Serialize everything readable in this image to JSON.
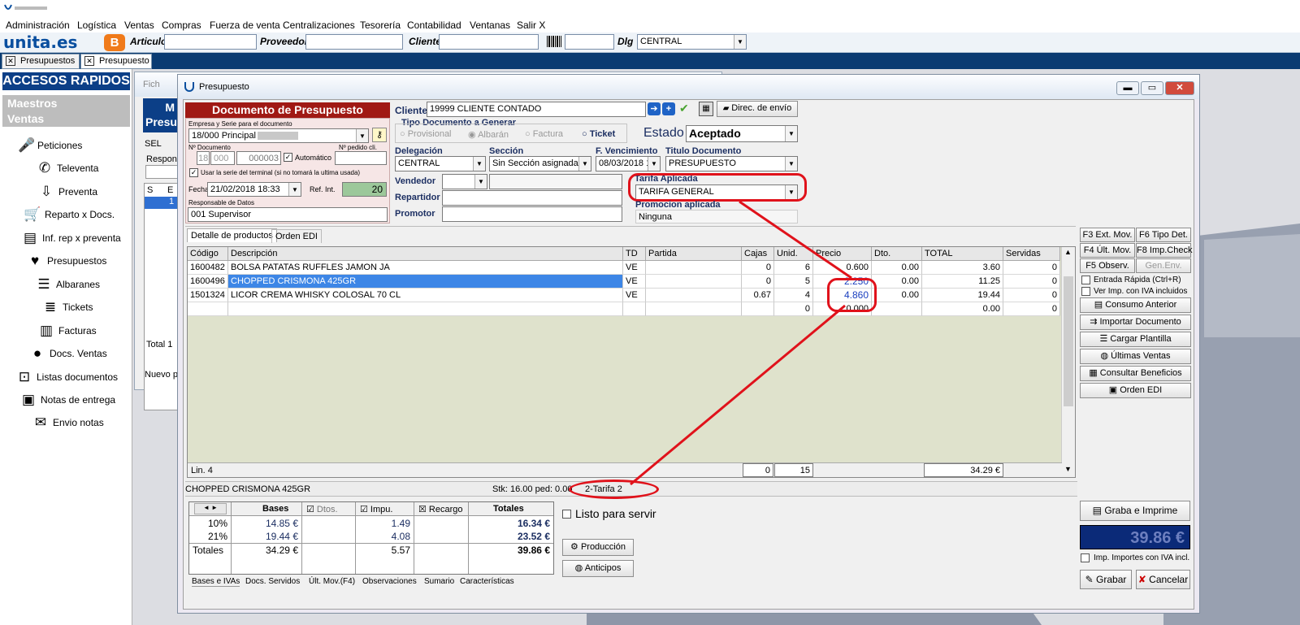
{
  "menu": [
    "Administración",
    "Logística",
    "Ventas",
    "Compras",
    "Fuerza de venta",
    "Centralizaciones",
    "Tesorería",
    "Contabilidad",
    "Ventanas",
    "Salir X"
  ],
  "toolbar": {
    "brand": "unita.es",
    "articulo_label": "Articulo",
    "proveedor_label": "Proveedor",
    "cliente_label": "Cliente",
    "dlg_label": "Dlg",
    "dlg_value": "CENTRAL"
  },
  "tabs": [
    "Presupuestos",
    "Presupuesto"
  ],
  "sidebar": {
    "title": "ACCESOS RAPIDOS",
    "section1": "Maestros",
    "section2": "Ventas",
    "items": [
      "Peticiones",
      "Televenta",
      "Preventa",
      "Reparto x Docs.",
      "Inf. rep x preventa",
      "Presupuestos",
      "Albaranes",
      "Tickets",
      "Facturas",
      "Docs. Ventas",
      "Listas documentos",
      "Notas de entrega",
      "Envio notas"
    ]
  },
  "bgwin": {
    "title": "Fich",
    "lines": [
      "M",
      "Presu"
    ],
    "sel": "SEL",
    "respon": "Respon",
    "col_s": "S",
    "col_e": "E",
    "row_val": "1",
    "total": "Total 1",
    "nuevo": "Nuevo p"
  },
  "win": {
    "title": "Presupuesto",
    "doc_header": "Documento de Presupuesto",
    "empresa_label": "Empresa y Serie para el documento",
    "empresa_value": "18/000 Principal",
    "ndoc_label": "Nº Documento",
    "npedido_label": "Nº pedido cli.",
    "ndoc_a": "18",
    "ndoc_b": "000",
    "ndoc_c": "000003",
    "automatico": "Automático",
    "usar_serie": "Usar la serie del terminal  (si no tomará la ultima usada)",
    "fecha_label": "Fecha",
    "fecha_value": "21/02/2018 18:33",
    "refint_label": "Ref. Int.",
    "refint_value": "20",
    "resp_label": "Responsable de Datos",
    "resp_value": "001 Supervisor",
    "cliente_label": "Cliente",
    "cliente_value": "19999 CLIENTE CONTADO",
    "direc_envio": "Direc. de envío",
    "tipo_doc_label": "Tipo Documento a Generar",
    "tipo_opts": [
      "Provisional",
      "Albarán",
      "Factura",
      "Ticket"
    ],
    "estado_label": "Estado",
    "estado_value": "Aceptado",
    "delegacion_label": "Delegación",
    "delegacion_value": "CENTRAL",
    "seccion_label": "Sección",
    "seccion_value": "Sin Sección asignada",
    "fvenc_label": "F. Vencimiento",
    "fvenc_value": "08/03/2018 1",
    "titulo_label": "Titulo Documento",
    "titulo_value": "PRESUPUESTO",
    "vendedor_label": "Vendedor",
    "repartidor_label": "Repartidor",
    "promotor_label": "Promotor",
    "tarifa_label": "Tarifa Aplicada",
    "tarifa_value": "TARIFA GENERAL",
    "promo_label": "Promocion aplicada",
    "promo_value": "Ninguna",
    "detail_tabs": [
      "Detalle de productos",
      "Orden EDI"
    ],
    "columns": [
      "Código",
      "Descripción",
      "TD",
      "Partida",
      "Cajas",
      "Unid.",
      "Precio",
      "Dto.",
      "TOTAL",
      "Servidas"
    ],
    "rows": [
      [
        "1600482",
        "BOLSA PATATAS RUFFLES JAMON JA",
        "VE",
        "",
        "0",
        "6",
        "0.600",
        "0.00",
        "3.60",
        "0"
      ],
      [
        "1600496",
        "CHOPPED CRISMONA 425GR",
        "VE",
        "",
        "0",
        "5",
        "2.250",
        "0.00",
        "11.25",
        "0"
      ],
      [
        "1501324",
        "LICOR CREMA WHISKY COLOSAL 70 CL",
        "VE",
        "",
        "0.67",
        "4",
        "4.860",
        "0.00",
        "19.44",
        "0"
      ],
      [
        "",
        "",
        "",
        "",
        "",
        "0",
        "0.000",
        "",
        "0.00",
        "0"
      ]
    ],
    "footer_lin": "Lin. 4",
    "footer_cajas": "0",
    "footer_unid": "15",
    "footer_total": "34.29 €",
    "status_desc": "CHOPPED CRISMONA 425GR",
    "status_stk": "Stk: 16.00 ped: 0.00",
    "status_tarifa": "2-Tarifa 2",
    "right_buttons": [
      [
        "F3 Ext. Mov.",
        "F6 Tipo Det."
      ],
      [
        "F4 Últ. Mov.",
        "F8 Imp.Check"
      ],
      [
        "F5 Observ.",
        "Gen.Env."
      ]
    ],
    "entrada_rapida": "Entrada Rápida (Ctrl+R)",
    "ver_imp": "Ver Imp. con IVA incluidos",
    "action_buttons": [
      "Consumo Anterior",
      "Importar Documento",
      "Cargar Plantilla",
      "Últimas Ventas",
      "Consultar Beneficios",
      "Orden EDI"
    ],
    "iva_headers": [
      "Bases",
      "Dtos.",
      "Impu.",
      "Recargo",
      "Totales"
    ],
    "iva_rows": [
      [
        "10%",
        "14.85 €",
        "",
        "1.49",
        "",
        "16.34 €"
      ],
      [
        "21%",
        "19.44 €",
        "",
        "4.08",
        "",
        "23.52 €"
      ],
      [
        "Totales",
        "34.29 €",
        "",
        "5.57",
        "",
        "39.86 €"
      ]
    ],
    "bottom_tabs": [
      "Bases e IVAs",
      "Docs. Servidos",
      "Últ. Mov.(F4)",
      "Observaciones",
      "Sumario",
      "Características"
    ],
    "listo": "Listo para servir",
    "produccion": "Producción",
    "anticipos": "Anticipos",
    "graba_imprime": "Graba e Imprime",
    "total_big": "39.86 €",
    "imp_iva_incl": "Imp. Importes con IVA incl.",
    "grabar": "Grabar",
    "cancelar": "Cancelar"
  },
  "colors": {
    "accent_red": "#e0121b",
    "nav_blue": "#0a3b72",
    "grid_bg": "#dfe2cc",
    "total_bg": "#0b2a78"
  }
}
